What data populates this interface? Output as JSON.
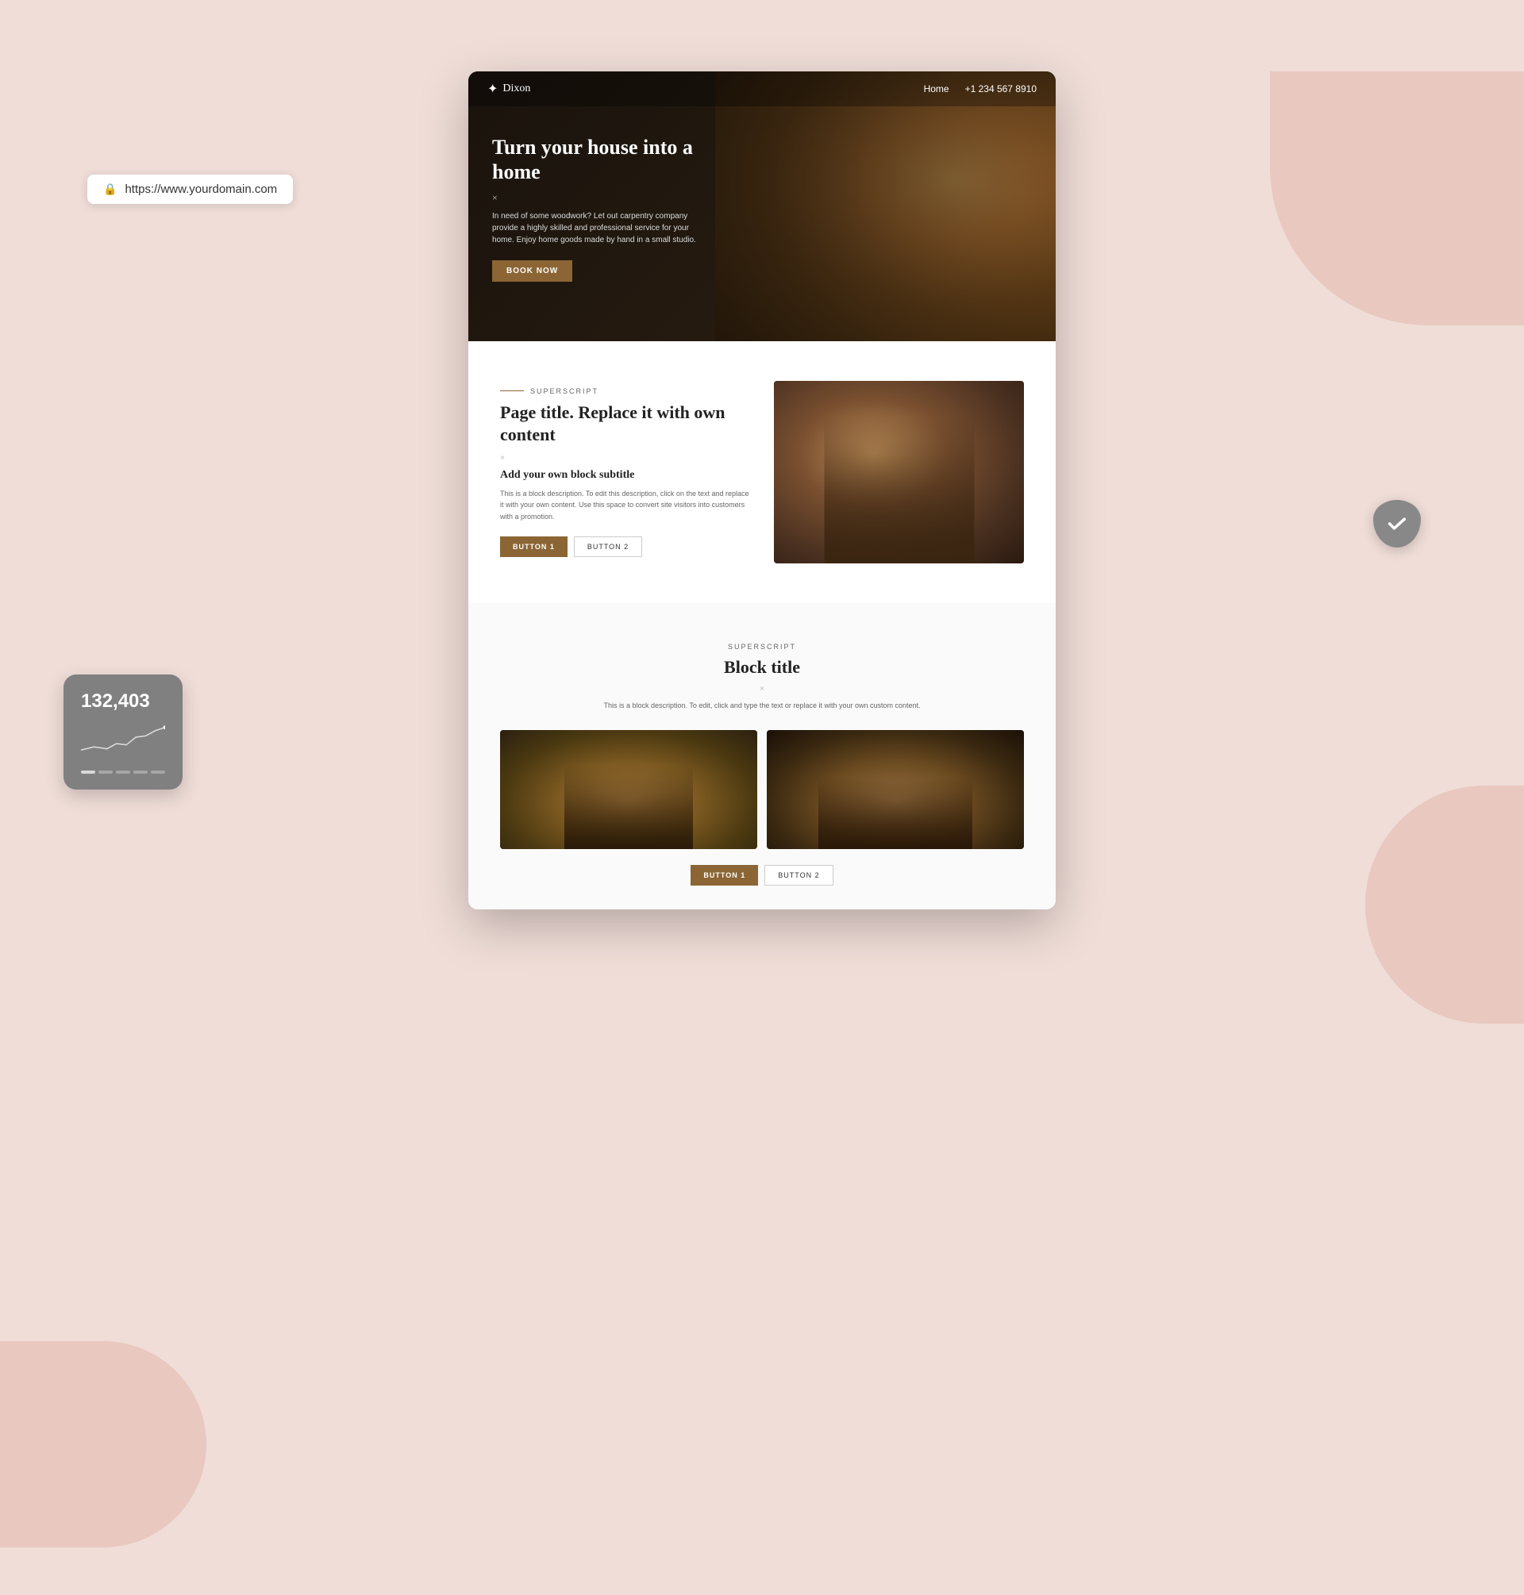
{
  "browser": {
    "url": "https://www.yourdomain.com",
    "lock_icon": "🔒"
  },
  "nav": {
    "logo_icon": "🌟",
    "logo_text": "Dixon",
    "links": [
      {
        "label": "Home",
        "href": "#"
      },
      {
        "label": "+1 234 567 8910",
        "href": "#"
      }
    ]
  },
  "hero": {
    "title": "Turn your house into a home",
    "x_symbol": "×",
    "description": "In need of some woodwork? Let out carpentry company provide a highly skilled and professional service for your home. Enjoy home goods made by hand in a small studio.",
    "cta_label": "BOOK NOW"
  },
  "section1": {
    "superscript": "SUPERSCRIPT",
    "title": "Page title. Replace it with own content",
    "x_symbol": "×",
    "subtitle": "Add your own block subtitle",
    "description": "This is a block description. To edit this description, click on the text and replace it with your own content. Use this space to convert site visitors into customers with a promotion.",
    "button1_label": "BUTTON 1",
    "button2_label": "BUTTON 2"
  },
  "section2": {
    "superscript": "SUPERSCRIPT",
    "title": "Block title",
    "x_symbol": "×",
    "description": "This is a block description. To edit, click and type the text or replace it with your own custom content.",
    "button1_label": "BUTTON 1",
    "button2_label": "BUTTON 2"
  },
  "stats_widget": {
    "number": "132,403"
  },
  "colors": {
    "accent": "#8B6534",
    "bg_light": "#f0ddd8",
    "hero_dark": "#2a1a0a"
  }
}
